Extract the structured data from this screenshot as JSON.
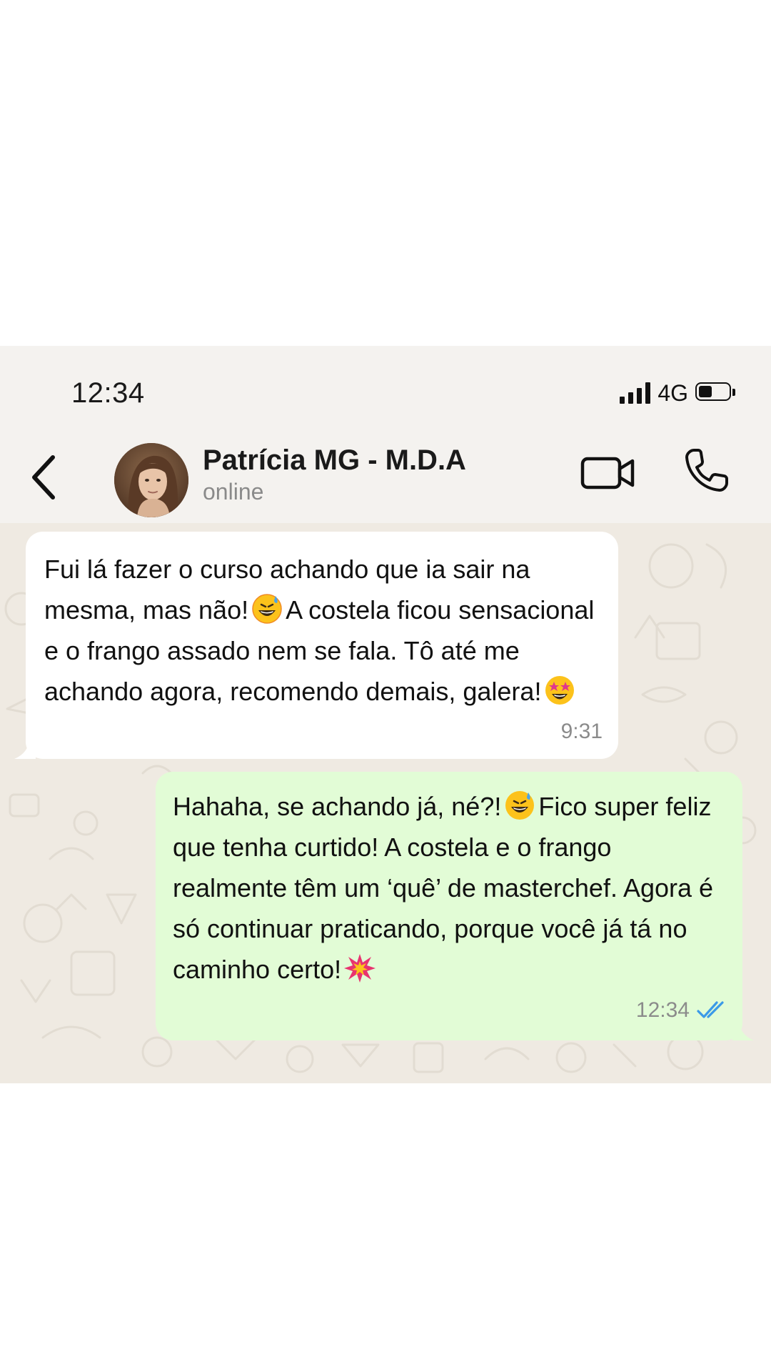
{
  "status_bar": {
    "time": "12:34",
    "network": "4G",
    "battery_level": 0.45,
    "signal_bars": 4
  },
  "header": {
    "contact_name": "Patrícia MG - M.D.A",
    "contact_status": "online"
  },
  "messages": [
    {
      "direction": "incoming",
      "parts": [
        "Fui lá fazer o curso achando que ia sair na mesma, mas não!",
        "A costela ficou sensacional e o frango assado nem se fala. Tô até me achando agora, recomendo demais, galera!"
      ],
      "emojis": [
        "grinning-sweat-emoji",
        "star-struck-emoji"
      ],
      "time": "9:31"
    },
    {
      "direction": "outgoing",
      "parts": [
        "Hahaha, se achando já, né?!",
        "Fico super feliz que tenha curtido! A costela e o frango realmente têm um ‘quê’ de masterchef. Agora é só continuar praticando, porque você já tá no caminho certo!"
      ],
      "emojis": [
        "grinning-sweat-emoji",
        "collision-emoji"
      ],
      "time": "12:34",
      "read": true
    }
  ],
  "colors": {
    "incoming_bubble": "#ffffff",
    "outgoing_bubble": "#e2fcd6",
    "read_ticks": "#3b9ae8",
    "header_bg": "#f4f2ef",
    "chat_bg": "#efeae2"
  }
}
